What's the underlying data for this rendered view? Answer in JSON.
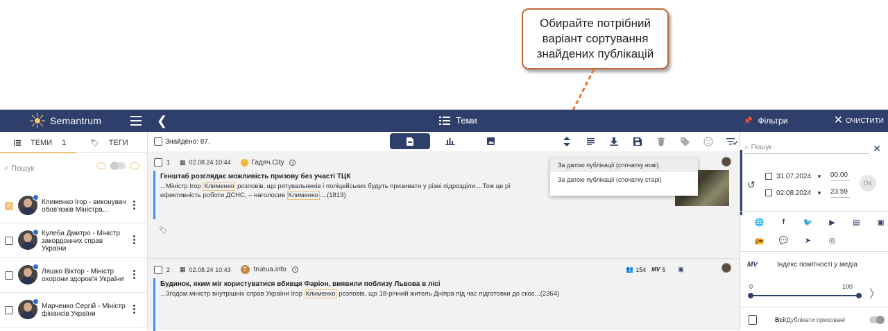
{
  "callout": {
    "line1": "Обирайте потрібний",
    "line2": "варіант сортування",
    "line3": "знайдених публікацій"
  },
  "topbar": {
    "brand": "Semantrum",
    "section_title": "Теми",
    "filters_label": "Фільтри",
    "clear_label": "ОЧИСТИТИ"
  },
  "left_panel": {
    "tab_topics": "ТЕМИ",
    "tab_topics_count": "1",
    "tab_tags": "ТЕГИ",
    "search_placeholder": "Пошук",
    "people": [
      {
        "name": "Клименко Ігор - виконувач обов'язків Міністра...",
        "checked": true
      },
      {
        "name": "Кулеба Дмитро - Міністр закордонних справ України",
        "checked": false
      },
      {
        "name": "Ляшко Віктор - Міністр охорони здоров'я України",
        "checked": false
      },
      {
        "name": "Марченко Сергій - Міністр фінансів України",
        "checked": false
      }
    ]
  },
  "main": {
    "found_label": "Знайдено: 87.",
    "publications": [
      {
        "index": "1",
        "datetime": "02.08.24 10:44",
        "source": "Гадяч.City",
        "title": "Генштаб розглядає можливість призову без участі ТЦК",
        "text_a": "...Міністр Ігор ",
        "highlight_a": "Клименко",
        "text_b": " розповів, що рятувальників і поліцейських будуть призивати у різні підрозділи....Тож це рі",
        "text_c": "ефективність роботи ДСНС, – наголосив ",
        "highlight_b": "Клименко",
        "text_d": "....(1813)"
      },
      {
        "index": "2",
        "datetime": "02.08.24 10:43",
        "source": "trueua.info",
        "audience": "154",
        "mv": "5",
        "title": "Будинок, яким міг користуватися вбивця Фаріон, виявили поблизу Львова в лісі",
        "text_a": "...Згодом міністр внутрішніх справ України Ігор ",
        "highlight_a": "Клименко",
        "text_b": " розповів, що 18-річний житель Дніпра під час підготовки до скоє...(2364)"
      }
    ]
  },
  "sort_dropdown": {
    "options": [
      "За датою публікації (спочатку нові)",
      "За датою публікації (спочатку старі)"
    ]
  },
  "filters": {
    "search_placeholder": "Пошук",
    "date_from": "31.07.2024",
    "time_from": "00:00",
    "date_to": "02.08.2024",
    "time_to": "23:59",
    "ok_label": "OK",
    "mv_label": "MV",
    "mv_caption": "Індекс помітності у медіа",
    "slider_min": "0",
    "slider_max": "100",
    "duplicates_all": "Всі",
    "duplicates_hidden": "/Дублікати приховані"
  },
  "colors": {
    "nav": "#2e3f6b",
    "accent": "#f0c27a",
    "callout_border": "#c0643a",
    "pub_bar": "#4a90e2"
  }
}
